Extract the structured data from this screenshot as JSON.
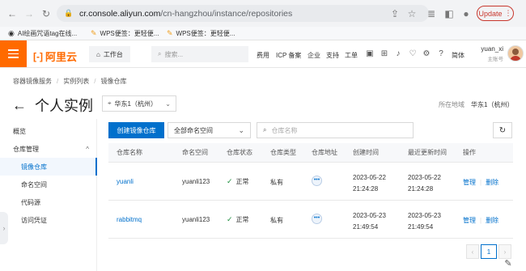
{
  "browser": {
    "url_host": "cr.console.aliyun.com",
    "url_path": "/cn-hangzhou/instance/repositories",
    "update_label": "Update",
    "bookmarks": [
      {
        "label": "AI绘画咒语tag在线..."
      },
      {
        "label": "WPS便签：更轻便..."
      },
      {
        "label": "WPS便签：更轻便..."
      }
    ]
  },
  "header": {
    "logo": "阿里云",
    "workbench_label": "工作台",
    "search_placeholder": "搜索...",
    "links": [
      "费用",
      "ICP 备案",
      "企业",
      "支持",
      "工单"
    ],
    "lang_label": "简体",
    "user_name": "yuan_xi",
    "user_sub": "主账号"
  },
  "breadcrumb": [
    "容器镜像服务",
    "实例列表",
    "镜像仓库"
  ],
  "title": {
    "text": "个人实例",
    "region_select": "华东1（杭州）",
    "region_info_label": "所在地域",
    "region_info_value": "华东1（杭州）"
  },
  "sidebar": {
    "items": [
      {
        "label": "概览"
      },
      {
        "label": "仓库管理"
      },
      {
        "label": "镜像仓库"
      },
      {
        "label": "命名空间"
      },
      {
        "label": "代码源"
      },
      {
        "label": "访问凭证"
      }
    ]
  },
  "toolbar": {
    "create_label": "创建镜像仓库",
    "namespace_select": "全部命名空间",
    "search_placeholder": "仓库名称"
  },
  "table": {
    "columns": [
      "仓库名称",
      "命名空间",
      "仓库状态",
      "仓库类型",
      "仓库地址",
      "创建时间",
      "最近更新时间",
      "操作"
    ],
    "rows": [
      {
        "name": "yuanli",
        "namespace": "yuanli123",
        "status": "正常",
        "type": "私有",
        "created_date": "2023-05-22",
        "created_time": "21:24:28",
        "updated_date": "2023-05-22",
        "updated_time": "21:24:28",
        "manage": "管理",
        "delete": "删除"
      },
      {
        "name": "rabbitmq",
        "namespace": "yuanli123",
        "status": "正常",
        "type": "私有",
        "created_date": "2023-05-23",
        "created_time": "21:49:54",
        "updated_date": "2023-05-23",
        "updated_time": "21:49:54",
        "manage": "管理",
        "delete": "删除"
      }
    ]
  },
  "pagination": {
    "current": "1"
  },
  "colors": {
    "accent": "#0070cc",
    "brand": "#ff6a00",
    "success": "#1e8e3e"
  }
}
